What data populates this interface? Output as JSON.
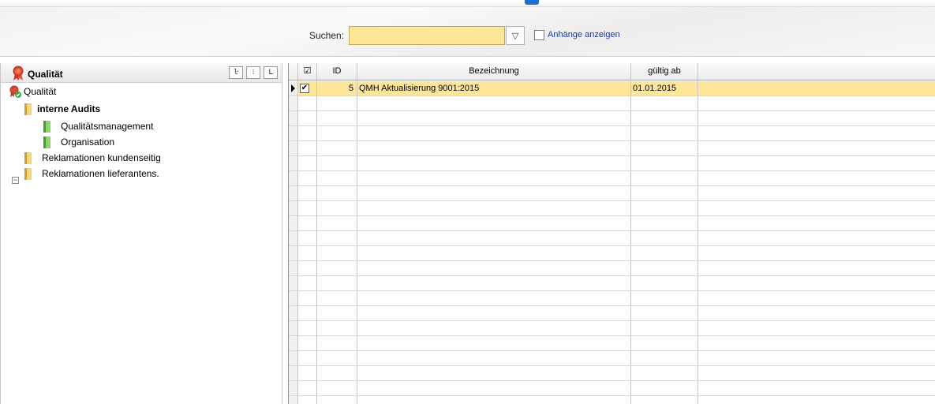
{
  "search": {
    "label": "Suchen:",
    "value": "",
    "filter_glyph": "▽",
    "attachments_label": "Anhänge anzeigen",
    "attachments_checked": false
  },
  "tree": {
    "title": "Qualität",
    "toolbar": [
      "expand-all",
      "collapse-all",
      "tree-view"
    ],
    "items": [
      {
        "label": "Qualität",
        "level": 0,
        "icon": "award-check-icon"
      },
      {
        "label": "interne Audits",
        "level": 0,
        "icon": "folder-icon",
        "expanded": true,
        "selected": true
      },
      {
        "label": "Qualitätsmanagement",
        "level": 1,
        "icon": "green-folder-icon"
      },
      {
        "label": "Organisation",
        "level": 1,
        "icon": "green-folder-icon"
      },
      {
        "label": "Reklamationen kundenseitig",
        "level": 0,
        "icon": "folder-icon"
      },
      {
        "label": "Reklamationen lieferantens.",
        "level": 0,
        "icon": "folder-icon"
      }
    ]
  },
  "grid": {
    "columns": [
      "☑",
      "ID",
      "Bezeichnung",
      "gültig ab"
    ],
    "rows": [
      {
        "checked": true,
        "id": "5",
        "bezeichnung": "QMH Aktualisierung 9001:2015",
        "gueltig_ab": "01.01.2015",
        "current": true
      }
    ],
    "colors": {
      "selected_row": "#fde69a",
      "search_field": "#fde69a"
    }
  }
}
